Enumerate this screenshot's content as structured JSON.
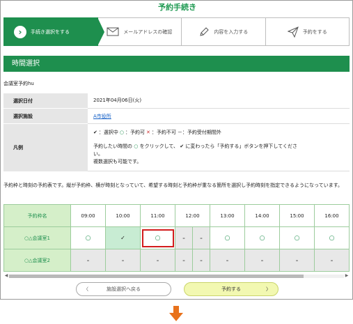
{
  "page": {
    "title": "予約手続き"
  },
  "steps": [
    {
      "label": "手続き選択をする",
      "icon": "circle-arrow-right-icon",
      "active": true
    },
    {
      "label": "メールアドレスの確認",
      "icon": "envelope-icon",
      "active": false
    },
    {
      "label": "内容を入力する",
      "icon": "pencil-icon",
      "active": false
    },
    {
      "label": "予約をする",
      "icon": "paper-plane-icon",
      "active": false
    }
  ],
  "section": {
    "title": "時間選択"
  },
  "facility": {
    "name": "会議室予約hu"
  },
  "info": {
    "date_label": "選択日付",
    "date_value": "2021年04月06日(火)",
    "facility_label": "選択施設",
    "facility_value": "A市役所",
    "legend_label": "凡例",
    "legend_selected": "：選択中",
    "legend_available": "：予約可",
    "legend_unavailable": "：予約不可",
    "legend_outside": "－：予約受付期間外",
    "instr_a": "予約したい時間の",
    "instr_b": "をクリックして、",
    "instr_c": "に変わったら「予約する」ボタンを押下してくださ",
    "instr_d": "い。",
    "instr_e": "複数選択も可能です。"
  },
  "description": "予約枠と時刻の予約表です。縦が予約枠、横が時刻となっていて、希望する時刻と予約枠が重なる箇所を選択し予約時刻を指定できるようになっています。",
  "schedule": {
    "corner_label": "予約枠名",
    "times": [
      "09:00",
      "10:00",
      "11:00",
      "12:00",
      "13:00",
      "14:00",
      "15:00",
      "16:00"
    ],
    "rows": [
      {
        "name": "○△会議室1",
        "cells": [
          "○",
          "✓",
          "○",
          "–",
          "–",
          "○",
          "○",
          "○",
          "○"
        ]
      },
      {
        "name": "○△会議室2",
        "cells": [
          "–",
          "–",
          "–",
          "–",
          "–",
          "–",
          "–",
          "–",
          "–"
        ]
      }
    ],
    "scroll_position": 0.88
  },
  "buttons": {
    "back": "施設選択へ戻る",
    "next": "予約する"
  },
  "colors": {
    "brand_green": "#1e8f4e",
    "selected_cell": "#c8ecd3",
    "header_cell": "#d5efc9",
    "highlight": "#d21c1c",
    "arrow": "#e8721c"
  }
}
